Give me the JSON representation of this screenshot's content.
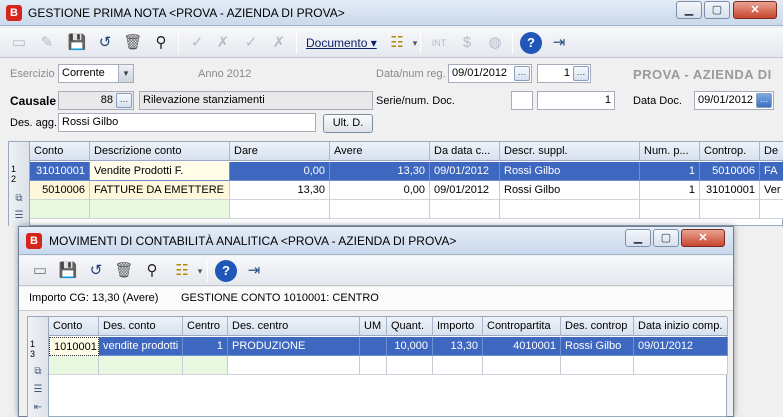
{
  "main": {
    "title": "GESTIONE PRIMA NOTA <PROVA - AZIENDA DI PROVA>",
    "app_icon": "B",
    "window_buttons": [
      "minimize-icon",
      "maximize-icon",
      "close-icon"
    ],
    "toolbar": {
      "icons": [
        "new-icon",
        "edit-icon",
        "save-icon",
        "undo-icon",
        "delete-icon",
        "search-icon"
      ],
      "disabled_icons": [
        "check-icon",
        "uncheck-icon",
        "check-alt-icon",
        "uncheck-alt-icon"
      ],
      "menu_documento": "Documento",
      "extra_icons": [
        "grid-options-icon",
        "int-icon",
        "currency-icon",
        "globe-icon",
        "help-icon",
        "exit-icon"
      ]
    },
    "form": {
      "esercizio_label": "Esercizio",
      "esercizio_value": "Corrente",
      "anno_label": "Anno 2012",
      "data_num_reg_label": "Data/num reg.",
      "data_reg": "09/01/2012",
      "num_reg": "1",
      "company": "PROVA - AZIENDA DI",
      "causale_label": "Causale",
      "causale_code": "88",
      "causale_desc": "Rilevazione stanziamenti",
      "serie_label": "Serie/num. Doc.",
      "serie_value": "",
      "num_doc": "1",
      "data_doc_label": "Data Doc.",
      "data_doc": "09/01/2012",
      "des_agg_label": "Des. agg.",
      "des_agg_value": "Rossi Gilbo",
      "ult_button": "Ult. D."
    },
    "grid": {
      "headers": [
        "Conto",
        "Descrizione conto",
        "Dare",
        "Avere",
        "Da data c...",
        "Descr. suppl.",
        "Num. p...",
        "Controp.",
        "De"
      ],
      "rows": [
        [
          "31010001",
          "Vendite Prodotti F.",
          "0,00",
          "13,30",
          "09/01/2012",
          "Rossi Gilbo",
          "1",
          "5010006",
          "FA"
        ],
        [
          "5010006",
          "FATTURE DA EMETTERE",
          "13,30",
          "0,00",
          "09/01/2012",
          "Rossi Gilbo",
          "1",
          "31010001",
          "Ver"
        ]
      ],
      "row_numbers": [
        "1",
        "2"
      ]
    }
  },
  "dialog": {
    "title": "MOVIMENTI DI CONTABILITÀ ANALITICA <PROVA - AZIENDA DI PROVA>",
    "toolbar_icons": [
      "new-icon",
      "save-icon",
      "undo-icon",
      "delete-icon",
      "search-icon",
      "grid-options-icon",
      "help-icon",
      "exit-icon"
    ],
    "importo_cg": "Importo CG: 13,30 (Avere)",
    "gestione_conto": "GESTIONE CONTO 1010001: CENTRO",
    "grid": {
      "headers": [
        "Conto",
        "Des. conto",
        "Centro",
        "Des. centro",
        "UM",
        "Quant.",
        "Importo",
        "Contropartita",
        "Des. controp",
        "Data inizio comp."
      ],
      "rows": [
        [
          "1010001",
          "vendite prodotti",
          "1",
          "PRODUZIONE",
          "",
          "10,000",
          "13,30",
          "4010001",
          "Rossi Gilbo",
          "09/01/2012"
        ]
      ],
      "row_numbers": [
        "1",
        "3"
      ]
    }
  }
}
